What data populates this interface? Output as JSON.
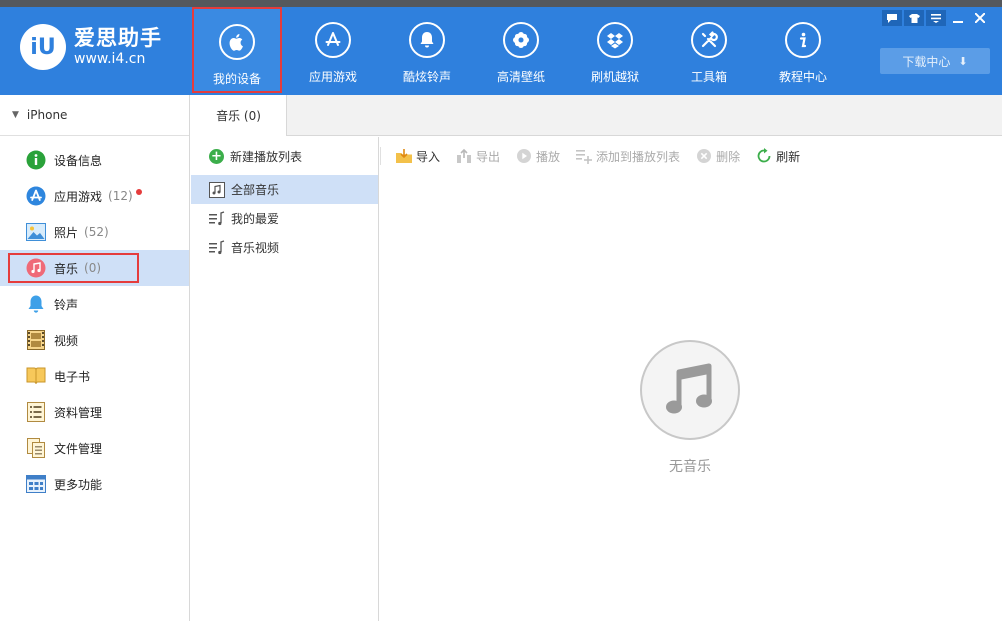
{
  "app": {
    "logo_mark": "iU",
    "logo_name": "爱思助手",
    "logo_url": "www.i4.cn"
  },
  "nav": [
    {
      "label": "我的设备",
      "icon": "apple-icon"
    },
    {
      "label": "应用游戏",
      "icon": "app-store-icon"
    },
    {
      "label": "酷炫铃声",
      "icon": "bell-icon"
    },
    {
      "label": "高清壁纸",
      "icon": "flower-icon"
    },
    {
      "label": "刷机越狱",
      "icon": "dropbox-icon"
    },
    {
      "label": "工具箱",
      "icon": "tools-icon"
    },
    {
      "label": "教程中心",
      "icon": "info-icon"
    }
  ],
  "download_center": "下载中心",
  "device_name": "iPhone",
  "sidebar": [
    {
      "label": "设备信息",
      "count": ""
    },
    {
      "label": "应用游戏",
      "count": "(12)"
    },
    {
      "label": "照片",
      "count": "(52)"
    },
    {
      "label": "音乐",
      "count": "(0)"
    },
    {
      "label": "铃声",
      "count": ""
    },
    {
      "label": "视频",
      "count": ""
    },
    {
      "label": "电子书",
      "count": ""
    },
    {
      "label": "资料管理",
      "count": ""
    },
    {
      "label": "文件管理",
      "count": ""
    },
    {
      "label": "更多功能",
      "count": ""
    }
  ],
  "tab": "音乐 (0)",
  "new_playlist": "新建播放列表",
  "playlists": [
    "全部音乐",
    "我的最爱",
    "音乐视频"
  ],
  "toolbar": {
    "import": "导入",
    "export": "导出",
    "play": "播放",
    "add_to_playlist": "添加到播放列表",
    "delete": "删除",
    "refresh": "刷新"
  },
  "empty_label": "无音乐",
  "colors": {
    "header": "#2f80dd",
    "highlight": "#e53c3c",
    "selected_row": "#cfe0f7"
  }
}
